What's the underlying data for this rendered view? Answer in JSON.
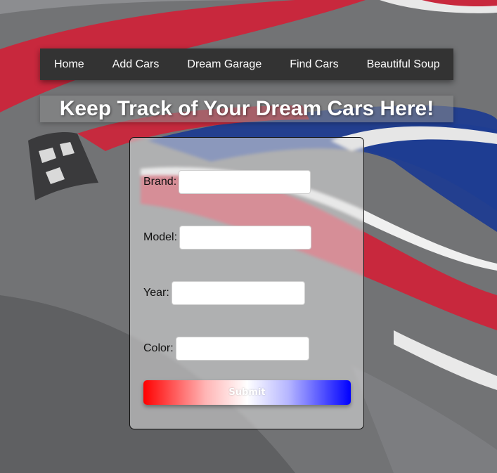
{
  "nav": {
    "items": [
      {
        "label": "Home"
      },
      {
        "label": "Add Cars"
      },
      {
        "label": "Dream Garage"
      },
      {
        "label": "Find Cars"
      },
      {
        "label": "Beautiful Soup"
      }
    ]
  },
  "headline": "Keep Track of Your Dream Cars Here!",
  "form": {
    "brand_label": "Brand:",
    "brand_value": "",
    "model_label": "Model:",
    "model_value": "",
    "year_label": "Year:",
    "year_value": "",
    "color_label": "Color:",
    "color_value": "",
    "submit_label": "Submit"
  },
  "colors": {
    "nav_bg": "#333333",
    "submit_gradient_start": "#ff0000",
    "submit_gradient_end": "#0000ff"
  }
}
